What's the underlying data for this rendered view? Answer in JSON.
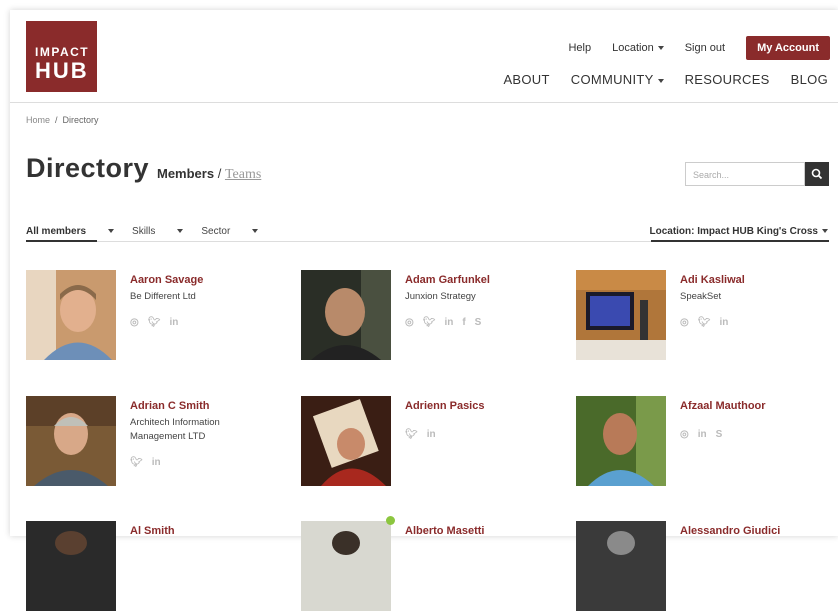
{
  "logo": {
    "line1": "IMPACT",
    "line2": "HUB"
  },
  "topnav": {
    "help": "Help",
    "location": "Location",
    "signout": "Sign out",
    "account": "My Account"
  },
  "mainnav": [
    {
      "label": "ABOUT"
    },
    {
      "label": "COMMUNITY"
    },
    {
      "label": "RESOURCES"
    },
    {
      "label": "BLOG"
    }
  ],
  "breadcrumb": {
    "home": "Home",
    "sep": "/",
    "current": "Directory"
  },
  "page": {
    "title": "Directory",
    "members_tab": "Members",
    "tab_sep": "/",
    "teams_tab": "Teams"
  },
  "search": {
    "placeholder": "Search..."
  },
  "filters": {
    "all_members": "All members",
    "skills": "Skills",
    "sector": "Sector",
    "location": "Location: Impact HUB King's Cross"
  },
  "members": [
    {
      "name": "Aaron Savage",
      "company": "Be Different Ltd",
      "socials": [
        "globe-icon",
        "twitter-icon",
        "linkedin-icon"
      ]
    },
    {
      "name": "Adam Garfunkel",
      "company": "Junxion Strategy",
      "socials": [
        "globe-icon",
        "twitter-icon",
        "linkedin-icon",
        "facebook-icon",
        "skype-icon"
      ]
    },
    {
      "name": "Adi Kasliwal",
      "company": "SpeakSet",
      "socials": [
        "globe-icon",
        "twitter-icon",
        "linkedin-icon"
      ]
    },
    {
      "name": "Adrian C Smith",
      "company": "Architech Information Management LTD",
      "socials": [
        "twitter-icon",
        "linkedin-icon"
      ]
    },
    {
      "name": "Adrienn Pasics",
      "company": "",
      "socials": [
        "twitter-icon",
        "linkedin-icon"
      ]
    },
    {
      "name": "Afzaal Mauthoor",
      "company": "",
      "socials": [
        "globe-icon",
        "linkedin-icon",
        "skype-icon"
      ]
    },
    {
      "name": "Al Smith",
      "company": "",
      "socials": []
    },
    {
      "name": "Alberto Masetti",
      "company": "",
      "socials": []
    },
    {
      "name": "Alessandro Giudici",
      "company": "",
      "socials": []
    }
  ]
}
